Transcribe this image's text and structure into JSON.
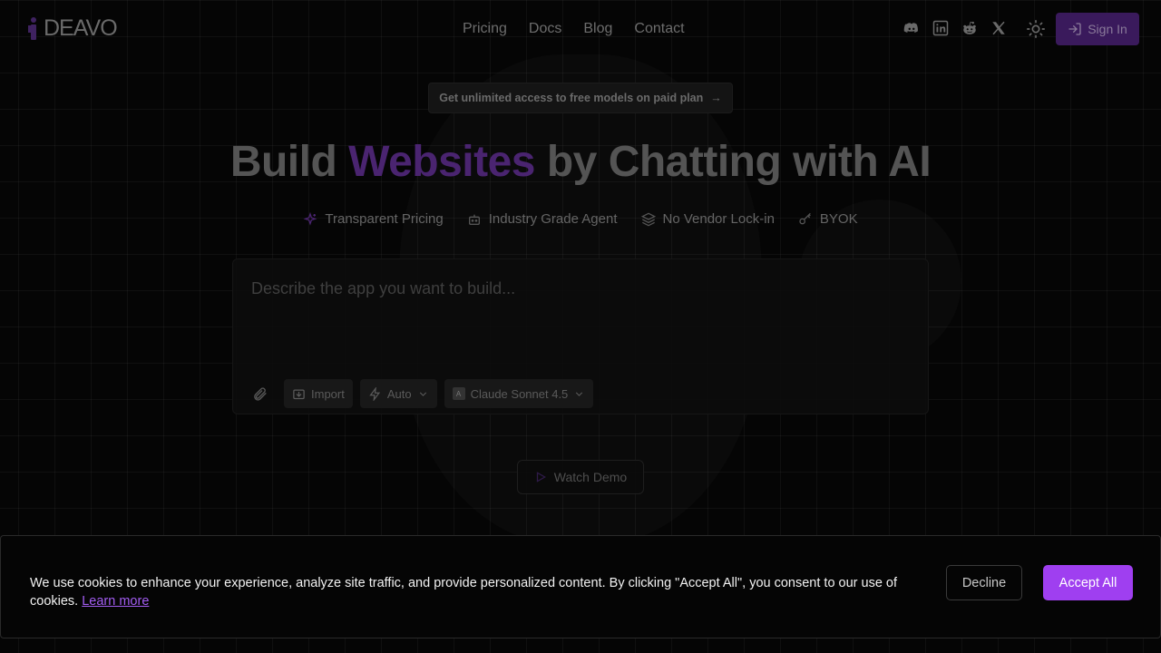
{
  "brand": {
    "name": "DEAVO",
    "accent_color": "#9f3ff0"
  },
  "nav": {
    "items": [
      "Pricing",
      "Docs",
      "Blog",
      "Contact"
    ]
  },
  "social": {
    "icons": [
      "discord-icon",
      "linkedin-icon",
      "reddit-icon",
      "x-icon"
    ]
  },
  "header": {
    "sign_in_label": "Sign In"
  },
  "announcement": {
    "text": "Get unlimited access to free models on paid plan",
    "arrow": "→"
  },
  "hero": {
    "headline_before": "Build",
    "headline_accent": "Websites",
    "headline_after": "by Chatting with AI",
    "features": [
      {
        "icon": "sparkles-icon",
        "label": "Transparent Pricing"
      },
      {
        "icon": "bot-icon",
        "label": "Industry Grade Agent"
      },
      {
        "icon": "layers-icon",
        "label": "No Vendor Lock-in"
      },
      {
        "icon": "key-icon",
        "label": "BYOK"
      }
    ]
  },
  "prompt": {
    "placeholder": "Describe the app you want to build...",
    "import_label": "Import",
    "mode_label": "Auto",
    "model_label": "Claude Sonnet 4.5"
  },
  "demo": {
    "label": "Watch Demo"
  },
  "cookie": {
    "text": "We use cookies to enhance your experience, analyze site traffic, and provide personalized content. By clicking \"Accept All\", you consent to our use of cookies.",
    "learn_more": "Learn more",
    "decline_label": "Decline",
    "accept_label": "Accept All"
  }
}
